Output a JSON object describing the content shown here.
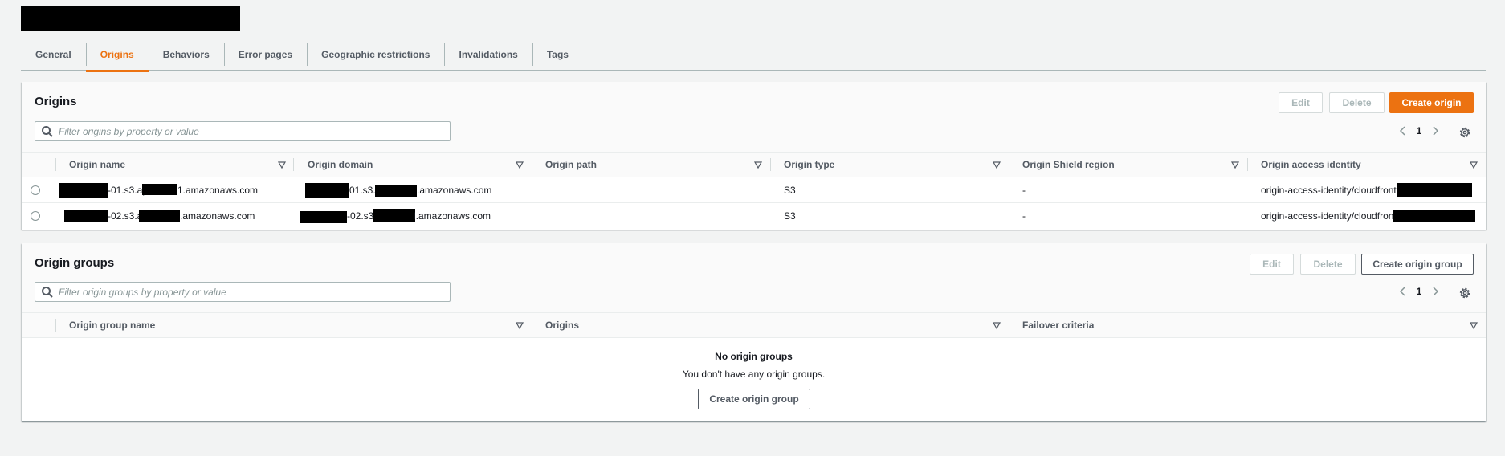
{
  "tabs": [
    "General",
    "Origins",
    "Behaviors",
    "Error pages",
    "Geographic restrictions",
    "Invalidations",
    "Tags"
  ],
  "active_tab": "Origins",
  "origins": {
    "title": "Origins",
    "edit_label": "Edit",
    "delete_label": "Delete",
    "create_label": "Create origin",
    "filter_placeholder": "Filter origins by property or value",
    "page": "1",
    "columns": [
      "Origin name",
      "Origin domain",
      "Origin path",
      "Origin type",
      "Origin Shield region",
      "Origin access identity"
    ],
    "rows": [
      {
        "name_a": "-01.s3.ap",
        "name_b": "1.amazonaws.com",
        "domain_a": "01.s3.",
        "domain_b": ".amazonaws.com",
        "path": "",
        "type": "S3",
        "shield": "-",
        "oai": "origin-access-identity/cloudfront/"
      },
      {
        "name_a": "-02.s3.a",
        "name_b": ".amazonaws.com",
        "domain_a": "-02.s3.",
        "domain_b": "l.amazonaws.com",
        "path": "",
        "type": "S3",
        "shield": "-",
        "oai": "origin-access-identity/cloudfront"
      }
    ]
  },
  "origin_groups": {
    "title": "Origin groups",
    "edit_label": "Edit",
    "delete_label": "Delete",
    "create_label": "Create origin group",
    "filter_placeholder": "Filter origin groups by property or value",
    "page": "1",
    "columns": [
      "Origin group name",
      "Origins",
      "Failover criteria"
    ],
    "empty_title": "No origin groups",
    "empty_text": "You don't have any origin groups.",
    "empty_button": "Create origin group"
  },
  "colors": {
    "accent": "#ec7211",
    "text": "#16191f",
    "muted": "#545b64",
    "background": "#f2f3f3"
  },
  "icons": [
    "search-icon",
    "chevron-left-icon",
    "chevron-right-icon",
    "gear-icon",
    "sort-icon"
  ]
}
